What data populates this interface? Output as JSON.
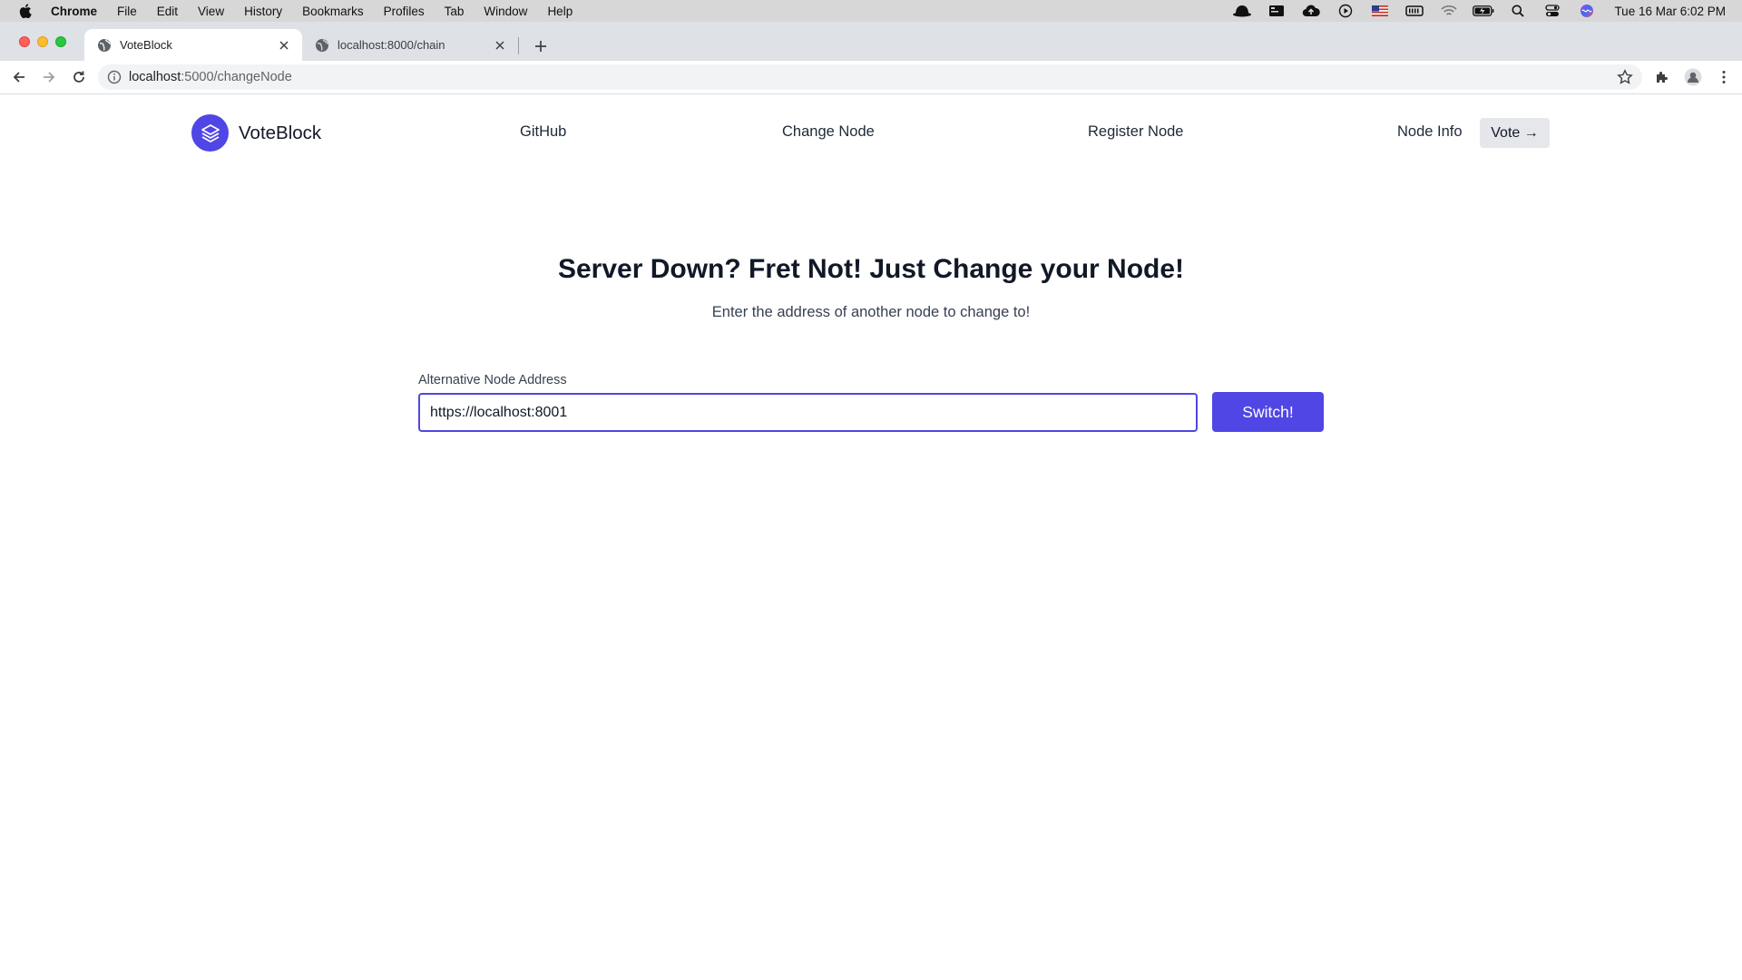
{
  "os_menubar": {
    "app_name": "Chrome",
    "menus": [
      "File",
      "Edit",
      "View",
      "History",
      "Bookmarks",
      "Profiles",
      "Tab",
      "Window",
      "Help"
    ],
    "clock": "Tue 16 Mar  6:02 PM"
  },
  "browser": {
    "tabs": [
      {
        "title": "VoteBlock",
        "active": true
      },
      {
        "title": "localhost:8000/chain",
        "active": false
      }
    ],
    "url_host": "localhost",
    "url_path": ":5000/changeNode"
  },
  "site": {
    "brand": "VoteBlock",
    "nav": {
      "github": "GitHub",
      "change_node": "Change Node",
      "register_node": "Register Node",
      "node_info": "Node Info",
      "vote": "Vote →"
    },
    "brand_color": "#4f46e5"
  },
  "main": {
    "title": "Server Down? Fret Not! Just Change your Node!",
    "subtitle": "Enter the address of another node to change to!",
    "field_label": "Alternative Node Address",
    "field_value": "https://localhost:8001",
    "submit_label": "Switch!"
  },
  "icons": {
    "brand_logo": "stack-layers-icon",
    "menubar_status": [
      "hat-icon",
      "screen-icon",
      "cloud-upload-icon",
      "play-icon",
      "us-flag-icon",
      "memory-icon",
      "wifi-icon",
      "battery-icon",
      "search-icon",
      "control-center-icon",
      "siri-icon"
    ]
  }
}
